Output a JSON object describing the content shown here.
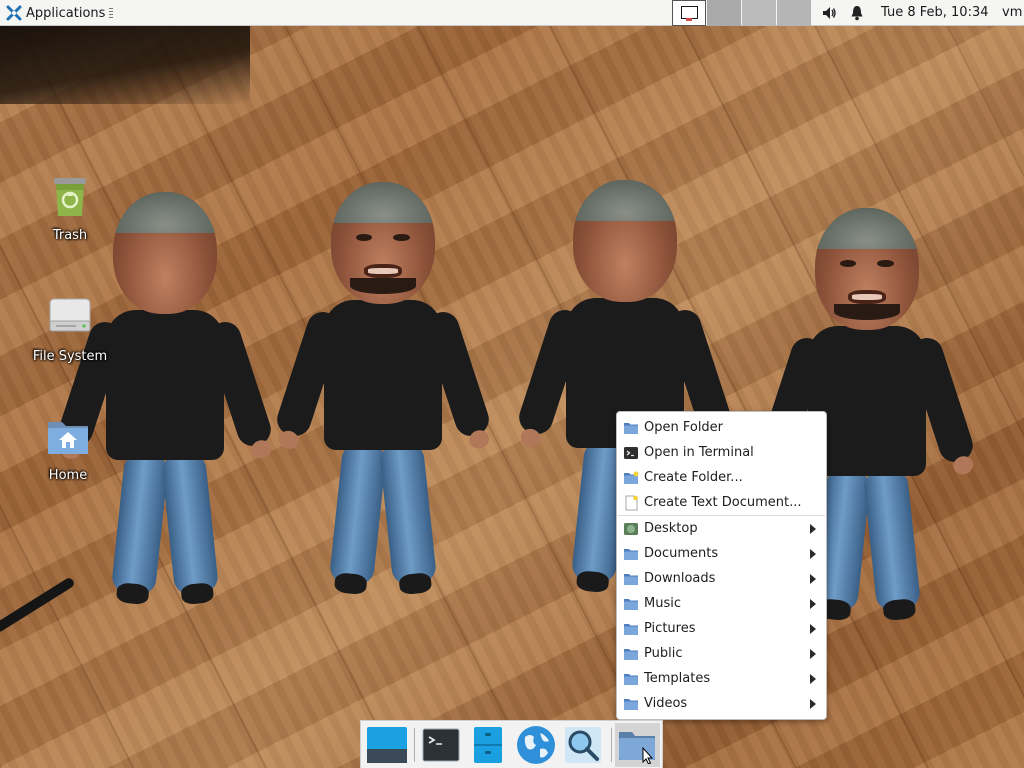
{
  "top_panel": {
    "applications_label": "Applications",
    "clock": "Tue  8 Feb, 10:34",
    "user": "vm",
    "workspaces": [
      {
        "id": 1,
        "active": true
      },
      {
        "id": 2,
        "active": false
      },
      {
        "id": 3,
        "active": false
      },
      {
        "id": 4,
        "active": false
      }
    ],
    "tray_icons": [
      "volume-icon",
      "notification-bell-icon"
    ]
  },
  "desktop_icons": [
    {
      "name": "trash",
      "label": "Trash",
      "icon": "trash-icon"
    },
    {
      "name": "file-system",
      "label": "File System",
      "icon": "drive-icon"
    },
    {
      "name": "home",
      "label": "Home",
      "icon": "home-folder-icon"
    }
  ],
  "context_menu": {
    "items": [
      {
        "label": "Open Folder",
        "icon": "folder-icon",
        "submenu": false
      },
      {
        "label": "Open in Terminal",
        "icon": "terminal-icon",
        "submenu": false
      },
      {
        "label": "Create Folder...",
        "icon": "folder-new-icon",
        "submenu": false
      },
      {
        "label": "Create Text Document...",
        "icon": "text-document-icon",
        "submenu": false
      },
      {
        "label": "Desktop",
        "icon": "desktop-folder-icon",
        "submenu": true
      },
      {
        "label": "Documents",
        "icon": "folder-icon",
        "submenu": true
      },
      {
        "label": "Downloads",
        "icon": "folder-icon",
        "submenu": true
      },
      {
        "label": "Music",
        "icon": "folder-icon",
        "submenu": true
      },
      {
        "label": "Pictures",
        "icon": "folder-icon",
        "submenu": true
      },
      {
        "label": "Public",
        "icon": "folder-icon",
        "submenu": true
      },
      {
        "label": "Templates",
        "icon": "folder-icon",
        "submenu": true
      },
      {
        "label": "Videos",
        "icon": "folder-icon",
        "submenu": true
      }
    ]
  },
  "dock": {
    "items": [
      {
        "name": "show-desktop",
        "icon": "desktop-icon"
      },
      {
        "name": "terminal",
        "icon": "terminal-icon"
      },
      {
        "name": "file-manager",
        "icon": "file-cabinet-icon"
      },
      {
        "name": "web-browser",
        "icon": "globe-icon"
      },
      {
        "name": "app-finder",
        "icon": "magnifier-icon"
      },
      {
        "name": "folder",
        "icon": "folder-icon",
        "active": true
      }
    ]
  },
  "colors": {
    "panel_bg": "#f5f5f4",
    "menu_bg": "#ffffff",
    "folder_blue": "#5b8fd0",
    "workspace_inactive": "#b3b3b3",
    "xfce_blue": "#1f6fb5"
  }
}
